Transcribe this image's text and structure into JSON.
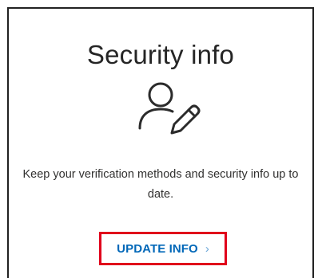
{
  "card": {
    "title": "Security info",
    "icon": "user-edit-icon",
    "description": "Keep your verification methods and security info up to date.",
    "action": {
      "label": "UPDATE INFO",
      "chevron": "›",
      "chevron_icon": "chevron-right-icon"
    }
  },
  "colors": {
    "link": "#0067b8",
    "highlight_border": "#e0001b",
    "text": "#323130"
  }
}
